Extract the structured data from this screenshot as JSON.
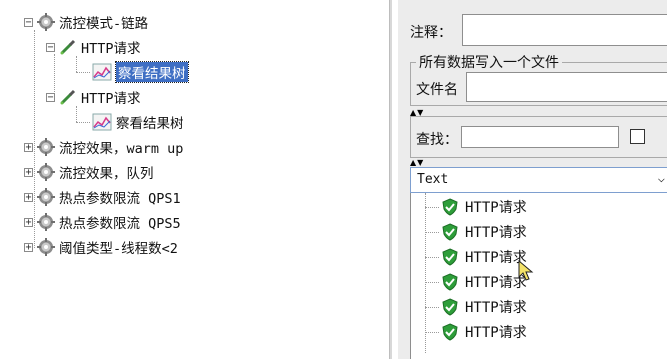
{
  "tree": {
    "nodes": [
      {
        "label": "流控模式-链路",
        "expander": "−",
        "icon": "gear-icon"
      },
      {
        "label": "HTTP请求",
        "expander": "−",
        "icon": "sampler-icon"
      },
      {
        "label": "察看结果树",
        "icon": "listener-icon",
        "selected": true
      },
      {
        "label": "HTTP请求",
        "expander": "−",
        "icon": "sampler-icon"
      },
      {
        "label": "察看结果树",
        "icon": "listener-icon"
      },
      {
        "label": "流控效果，warm up",
        "expander": "+",
        "icon": "gear-icon"
      },
      {
        "label": "流控效果，队列",
        "expander": "+",
        "icon": "gear-icon"
      },
      {
        "label": "热点参数限流 QPS1",
        "expander": "+",
        "icon": "gear-icon"
      },
      {
        "label": "热点参数限流 QPS5",
        "expander": "+",
        "icon": "gear-icon"
      },
      {
        "label": "阈值类型-线程数<2",
        "expander": "+",
        "icon": "gear-icon"
      }
    ]
  },
  "panel": {
    "comment_label": "注释：",
    "comment_value": "",
    "file_group_title": "所有数据写入一个文件",
    "filename_label": "文件名",
    "filename_value": "",
    "search_label": "查找：",
    "search_value": "",
    "renderer_selected": "Text",
    "results": [
      {
        "label": "HTTP请求",
        "status": "success"
      },
      {
        "label": "HTTP请求",
        "status": "success"
      },
      {
        "label": "HTTP请求",
        "status": "success"
      },
      {
        "label": "HTTP请求",
        "status": "success"
      },
      {
        "label": "HTTP请求",
        "status": "success"
      },
      {
        "label": "HTTP请求",
        "status": "success"
      }
    ]
  },
  "colors": {
    "selection": "#3f6fc4",
    "success": "#2e9e3a",
    "panel_bg": "#ececec"
  }
}
